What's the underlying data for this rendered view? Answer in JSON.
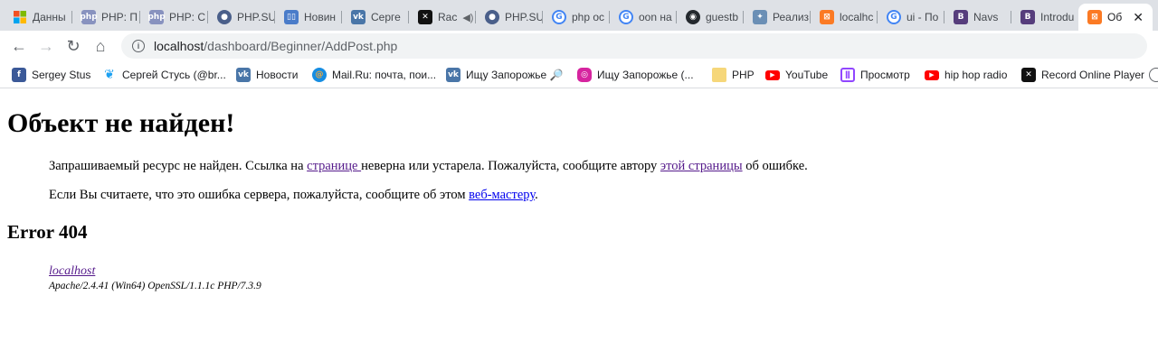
{
  "tabs": [
    {
      "label": "Данны",
      "icon": "windows-icon"
    },
    {
      "label": "PHP: П",
      "icon": "php-icon"
    },
    {
      "label": "PHP: С",
      "icon": "php-icon"
    },
    {
      "label": "PHP.SU",
      "icon": "phpsu-icon"
    },
    {
      "label": "Новин",
      "icon": "trello-icon"
    },
    {
      "label": "Серге",
      "icon": "vk-icon"
    },
    {
      "label": "Rac",
      "icon": "record-icon"
    },
    {
      "label": "PHP.SU",
      "icon": "phpsu-icon"
    },
    {
      "label": "php oc",
      "icon": "google-icon"
    },
    {
      "label": "oon на",
      "icon": "google-icon"
    },
    {
      "label": "guestb",
      "icon": "github-icon"
    },
    {
      "label": "Реализ",
      "icon": "puzzle-icon"
    },
    {
      "label": "localhc",
      "icon": "xampp-icon"
    },
    {
      "label": "ui - По",
      "icon": "google-icon"
    },
    {
      "label": "Navs",
      "icon": "bootstrap-icon"
    },
    {
      "label": "Introdu",
      "icon": "bootstrap-icon"
    },
    {
      "label": "Об",
      "icon": "xampp-icon",
      "active": true
    }
  ],
  "toolbar": {
    "url_host": "localhost",
    "url_path": "/dashboard/Beginner/AddPost.php"
  },
  "bookmarks": [
    {
      "label": "Sergey Stus",
      "icon": "facebook-icon"
    },
    {
      "label": "Сергей Стусь (@br...",
      "icon": "twitter-icon"
    },
    {
      "label": "Новости",
      "icon": "vk-icon"
    },
    {
      "label": "Mail.Ru: почта, пои...",
      "icon": "mailru-icon"
    },
    {
      "label": "Ищу Запорожье 🔎",
      "icon": "vk-icon"
    },
    {
      "label": "Ищу Запорожье (...",
      "icon": "instagram-icon"
    },
    {
      "label": "PHP",
      "icon": "folder-icon"
    },
    {
      "label": "YouTube",
      "icon": "youtube-icon"
    },
    {
      "label": "Просмотр",
      "icon": "twitch-icon"
    },
    {
      "label": "hip hop radio",
      "icon": "youtube-icon"
    },
    {
      "label": "Record Online Player",
      "icon": "record-icon"
    }
  ],
  "page": {
    "heading": "Объект не найден!",
    "p1_before": "Запрашиваемый ресурс не найден. Ссылка на ",
    "p1_link1": "странице ",
    "p1_middle": "неверна или устарела. Пожалуйста, сообщите автору ",
    "p1_link2": "этой страницы",
    "p1_after": " об ошибке.",
    "p2_before": "Если Вы считаете, что это ошибка сервера, пожалуйста, сообщите об этом ",
    "p2_link": "веб-мастеру",
    "p2_after": ".",
    "error_heading": "Error 404",
    "server_link": "localhost",
    "server_signature": "Apache/2.4.41 (Win64) OpenSSL/1.1.1c PHP/7.3.9"
  }
}
